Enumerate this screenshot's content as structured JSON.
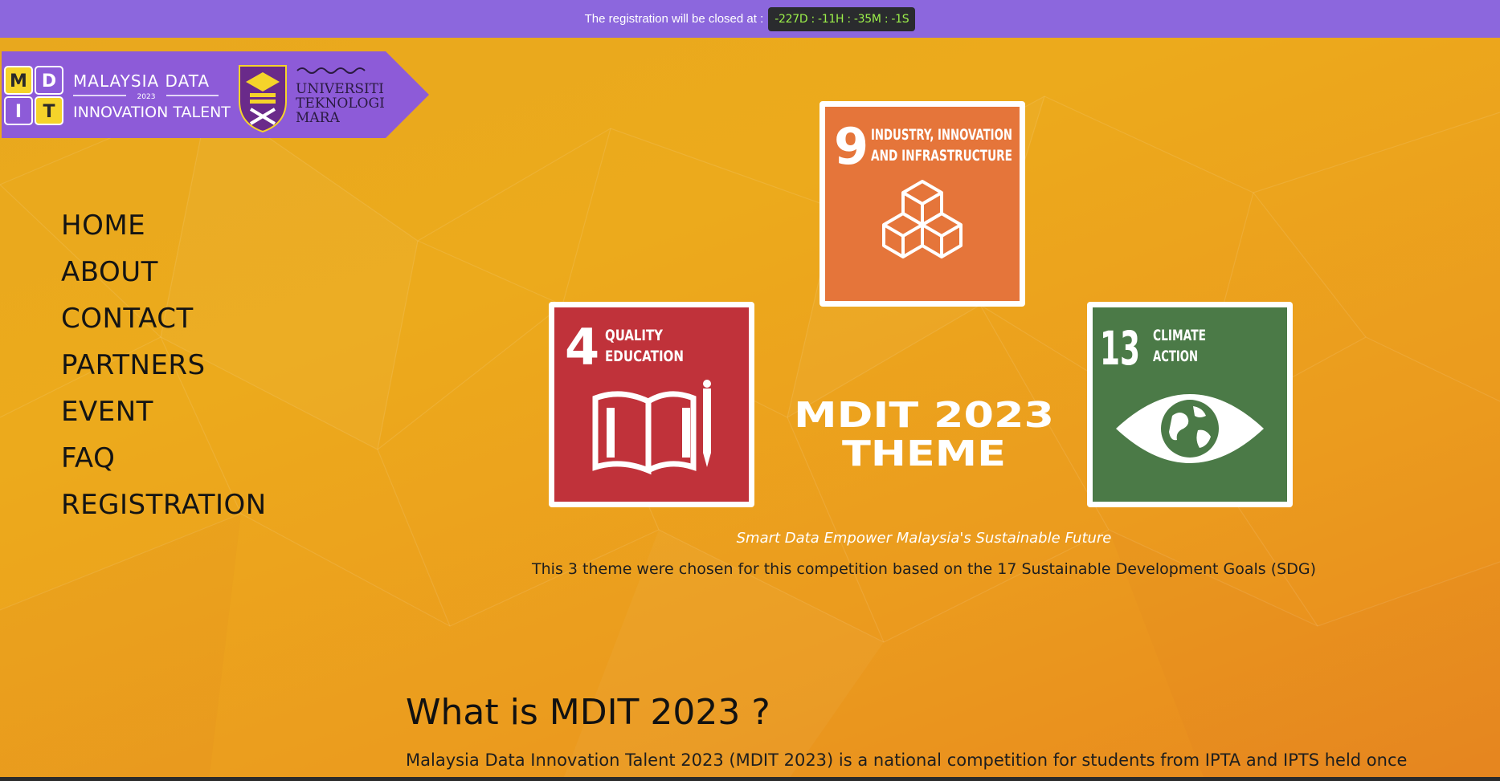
{
  "topbar": {
    "message": "The registration will be closed at :",
    "countdown": "-227D : -11H : -35M : -1S"
  },
  "brand": {
    "logo_letters": [
      "M",
      "D",
      "I",
      "T"
    ],
    "name_line1": "MALAYSIA DATA",
    "year": "2023",
    "name_line2": "INNOVATION TALENT",
    "university_line1": "UNIVERSITI",
    "university_line2": "TEKNOLOGI",
    "university_line3": "MARA"
  },
  "nav": {
    "items": [
      {
        "label": "HOME"
      },
      {
        "label": "ABOUT"
      },
      {
        "label": "CONTACT"
      },
      {
        "label": "PARTNERS"
      },
      {
        "label": "EVENT"
      },
      {
        "label": "FAQ"
      },
      {
        "label": "REGISTRATION"
      }
    ]
  },
  "theme": {
    "title_line1": "MDIT 2023",
    "title_line2": "THEME",
    "cards": [
      {
        "number": "9",
        "line1": "INDUSTRY, INNOVATION",
        "line2": "AND INFRASTRUCTURE",
        "color": "#e5753a",
        "icon": "cubes-icon"
      },
      {
        "number": "4",
        "line1": "QUALITY",
        "line2": "EDUCATION",
        "color": "#c0323a",
        "icon": "book-pencil-icon"
      },
      {
        "number": "13",
        "line1": "CLIMATE",
        "line2": "ACTION",
        "color": "#4b7a47",
        "icon": "eye-globe-icon"
      }
    ],
    "tagline": "Smart Data Empower Malaysia's Sustainable Future",
    "subtitle": "This 3 theme were chosen for this competition based on the 17 Sustainable Development Goals (SDG)"
  },
  "about": {
    "heading": "What is MDIT 2023 ?",
    "text": "Malaysia Data Innovation Talent 2023 (MDIT 2023) is a national competition for students from IPTA and IPTS held once"
  },
  "colors": {
    "topbar": "#8c67dd",
    "timer_text": "#9cf04a",
    "background": "#eba51d",
    "logo_yellow": "#f5d32a",
    "logo_purple": "#8d5bd8"
  }
}
